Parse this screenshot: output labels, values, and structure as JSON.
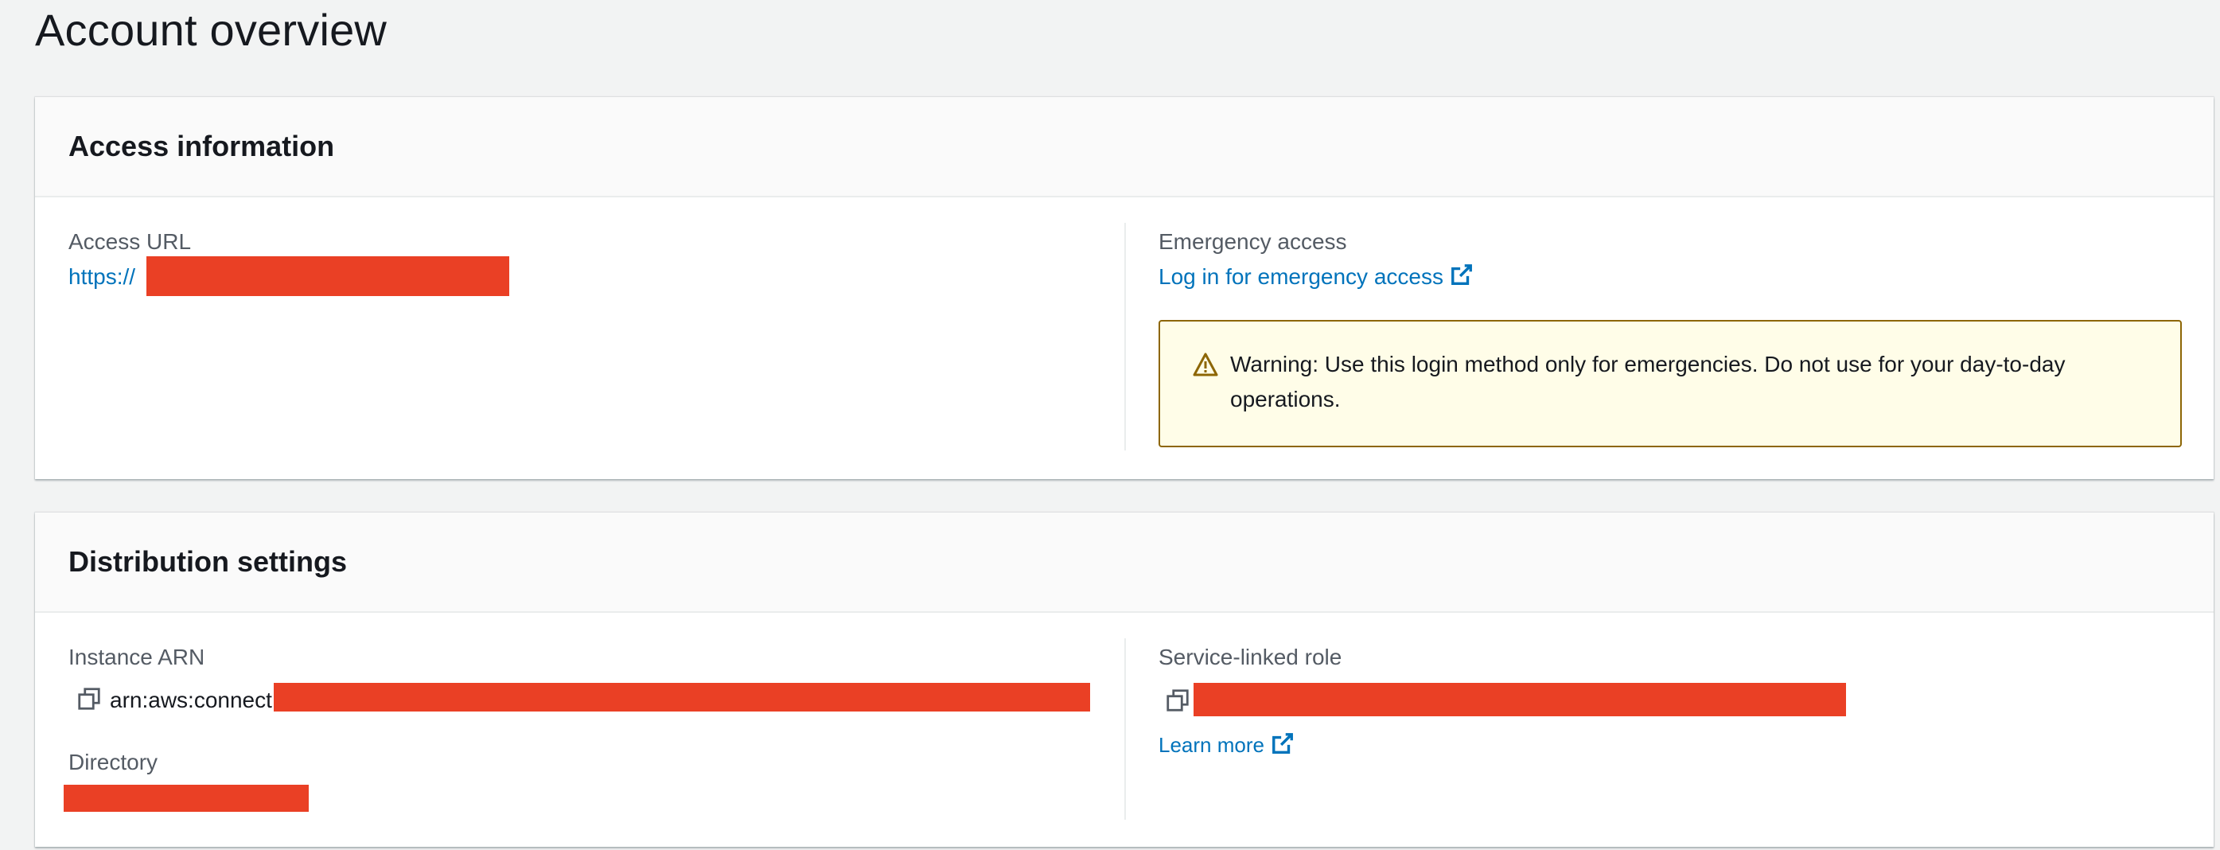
{
  "page": {
    "title": "Account overview"
  },
  "access_information": {
    "heading": "Access information",
    "access_url_label": "Access URL",
    "access_url_prefix": "https://",
    "emergency_label": "Emergency access",
    "emergency_link": "Log in for emergency access",
    "warning_text": "Warning: Use this login method only for emergencies. Do not use for your day-to-day operations."
  },
  "distribution_settings": {
    "heading": "Distribution settings",
    "instance_arn_label": "Instance ARN",
    "instance_arn_prefix": "arn:aws:connect",
    "directory_label": "Directory",
    "service_role_label": "Service-linked role",
    "learn_more_link": "Learn more"
  },
  "colors": {
    "link": "#0073bb",
    "redaction": "#ea4025",
    "warning_bg": "#fffde8",
    "warning_border": "#8d6605"
  },
  "icons": [
    "external-link-icon",
    "warning-icon",
    "copy-icon"
  ]
}
